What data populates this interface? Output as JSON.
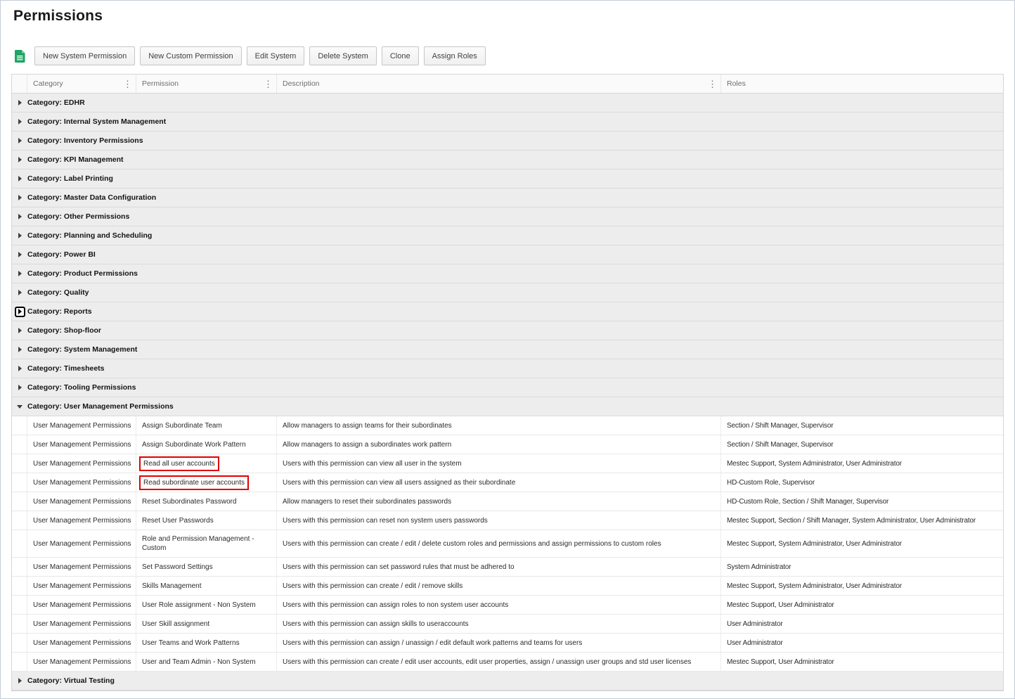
{
  "page": {
    "title": "Permissions"
  },
  "toolbar": {
    "buttons": [
      {
        "label": "New System Permission"
      },
      {
        "label": "New Custom Permission"
      },
      {
        "label": "Edit System"
      },
      {
        "label": "Delete System"
      },
      {
        "label": "Clone"
      },
      {
        "label": "Assign Roles"
      }
    ]
  },
  "grid": {
    "columns": [
      {
        "label": "Category",
        "menu": true
      },
      {
        "label": "Permission",
        "menu": true
      },
      {
        "label": "Description",
        "menu": true
      },
      {
        "label": "Roles",
        "menu": false
      }
    ],
    "groups": [
      {
        "label": "Category: EDHR"
      },
      {
        "label": "Category: Internal System Management"
      },
      {
        "label": "Category: Inventory Permissions"
      },
      {
        "label": "Category: KPI Management"
      },
      {
        "label": "Category: Label Printing"
      },
      {
        "label": "Category: Master Data Configuration"
      },
      {
        "label": "Category: Other Permissions"
      },
      {
        "label": "Category: Planning and Scheduling"
      },
      {
        "label": "Category: Power BI"
      },
      {
        "label": "Category: Product Permissions"
      },
      {
        "label": "Category: Quality"
      },
      {
        "label": "Category: Reports",
        "focused": true
      },
      {
        "label": "Category: Shop-floor"
      },
      {
        "label": "Category: System Management"
      },
      {
        "label": "Category: Timesheets"
      },
      {
        "label": "Category: Tooling Permissions"
      },
      {
        "label": "Category: User Management Permissions",
        "expanded": true,
        "rows": [
          {
            "category": "User Management Permissions",
            "permission": "Assign Subordinate Team",
            "description": "Allow managers to assign teams for their subordinates",
            "roles": "Section / Shift Manager, Supervisor"
          },
          {
            "category": "User Management Permissions",
            "permission": "Assign Subordinate Work Pattern",
            "description": "Allow managers to assign a subordinates work pattern",
            "roles": "Section / Shift Manager, Supervisor"
          },
          {
            "category": "User Management Permissions",
            "permission": "Read all user accounts",
            "description": "Users with this permission can view all user in the system",
            "roles": "Mestec Support, System Administrator, User Administrator",
            "highlighted": true
          },
          {
            "category": "User Management Permissions",
            "permission": "Read subordinate user accounts",
            "description": "Users with this permission can view all users assigned as their subordinate",
            "roles": "HD-Custom Role, Supervisor",
            "highlighted": true
          },
          {
            "category": "User Management Permissions",
            "permission": "Reset Subordinates Password",
            "description": "Allow managers to reset their subordinates passwords",
            "roles": "HD-Custom Role, Section / Shift Manager, Supervisor"
          },
          {
            "category": "User Management Permissions",
            "permission": "Reset User Passwords",
            "description": "Users with this permission can reset non system users passwords",
            "roles": "Mestec Support, Section / Shift Manager, System Administrator, User Administrator"
          },
          {
            "category": "User Management Permissions",
            "permission": "Role and Permission Management - Custom",
            "description": "Users with this permission can create / edit / delete custom roles and permissions and assign permissions to custom roles",
            "roles": "Mestec Support, System Administrator, User Administrator"
          },
          {
            "category": "User Management Permissions",
            "permission": "Set Password Settings",
            "description": "Users with this permission can set password rules that must be adhered to",
            "roles": "System Administrator"
          },
          {
            "category": "User Management Permissions",
            "permission": "Skills Management",
            "description": "Users with this permission can create / edit / remove skills",
            "roles": "Mestec Support, System Administrator, User Administrator"
          },
          {
            "category": "User Management Permissions",
            "permission": "User Role assignment - Non System",
            "description": "Users with this permission can assign roles to non system user accounts",
            "roles": "Mestec Support, User Administrator"
          },
          {
            "category": "User Management Permissions",
            "permission": "User Skill assignment",
            "description": "Users with this permission can assign skills to useraccounts",
            "roles": "User Administrator"
          },
          {
            "category": "User Management Permissions",
            "permission": "User Teams and Work Patterns",
            "description": "Users with this permission can assign / unassign / edit default work patterns and teams for users",
            "roles": "User Administrator"
          },
          {
            "category": "User Management Permissions",
            "permission": "User and Team Admin - Non System",
            "description": "Users with this permission can create / edit user accounts, edit user properties, assign / unassign user groups and std user licenses",
            "roles": "Mestec Support, User Administrator"
          }
        ]
      },
      {
        "label": "Category: Virtual Testing"
      }
    ]
  },
  "colors": {
    "highlight_red": "#e00000",
    "excel_green": "#21a366",
    "excel_green_light": "#6fd09a",
    "group_bg": "#ededed",
    "header_bg": "#fafafa"
  }
}
